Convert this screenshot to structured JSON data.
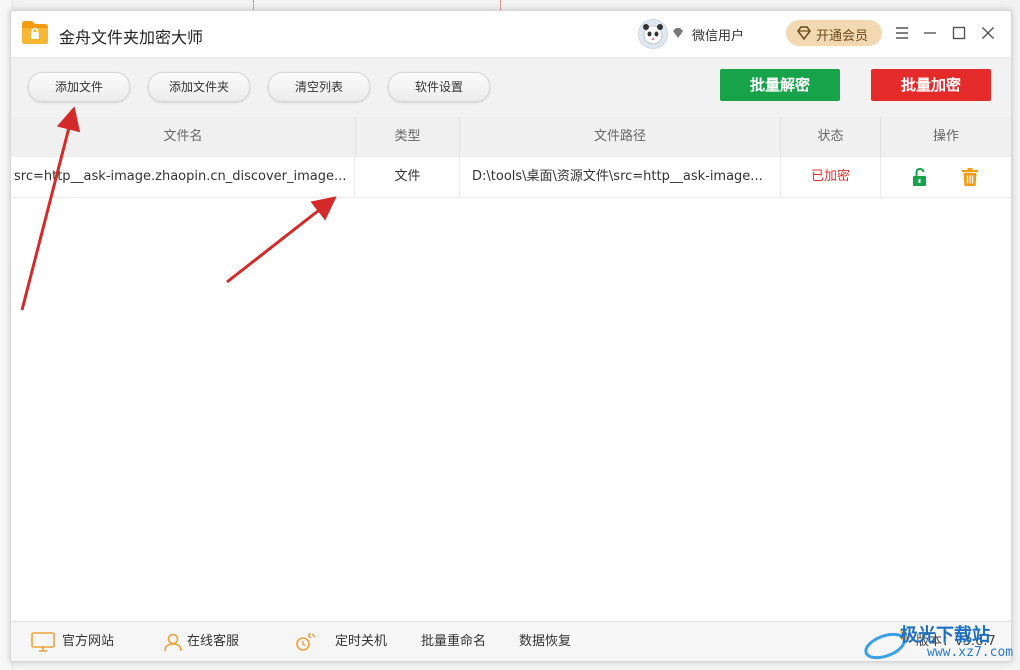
{
  "app": {
    "title": "金舟文件夹加密大师",
    "user_name": "微信用户",
    "vip_label": "开通会员"
  },
  "toolbar": {
    "buttons": [
      "添加文件",
      "添加文件夹",
      "清空列表",
      "软件设置"
    ],
    "batch_decrypt": "批量解密",
    "batch_encrypt": "批量加密"
  },
  "table": {
    "headers": [
      "文件名",
      "类型",
      "文件路径",
      "状态",
      "操作"
    ],
    "rows": [
      {
        "name": "src=http__ask-image.zhaopin.cn_discover_image...",
        "type": "文件",
        "path": "D:\\tools\\桌面\\资源文件\\src=http__ask-image...",
        "status": "已加密"
      }
    ]
  },
  "footer": {
    "items": [
      "官方网站",
      "在线客服",
      "定时关机",
      "批量重命名",
      "数据恢复"
    ],
    "version": "版本：v3.6.7"
  },
  "watermark": {
    "text": "极光下载站",
    "url": "www.xz7.com"
  },
  "colors": {
    "green": "#17a34a",
    "red": "#e52a2a",
    "status_red": "#e03131",
    "vip_bg": "#f3d9b1",
    "arrow": "#d42a2a"
  },
  "icons": [
    "folder-lock-logo-icon",
    "panda-avatar-icon",
    "diamond-icon",
    "menu-icon",
    "minimize-icon",
    "maximize-icon",
    "close-icon",
    "unlock-icon",
    "trash-icon",
    "monitor-icon",
    "person-icon",
    "timer-icon"
  ]
}
